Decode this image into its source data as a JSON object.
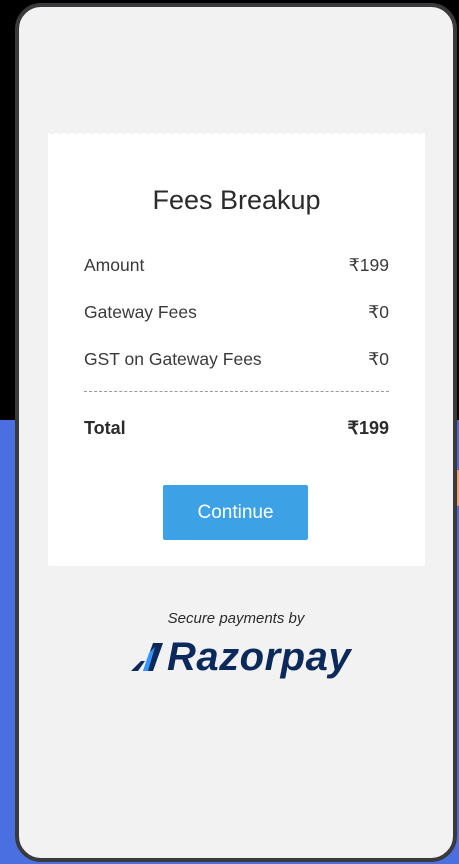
{
  "card": {
    "title": "Fees Breakup",
    "rows": [
      {
        "label": "Amount",
        "value": "₹199"
      },
      {
        "label": "Gateway Fees",
        "value": "₹0"
      },
      {
        "label": "GST on Gateway Fees",
        "value": "₹0"
      }
    ],
    "total": {
      "label": "Total",
      "value": "₹199"
    },
    "continue_label": "Continue"
  },
  "footer": {
    "secure_text": "Secure payments by",
    "brand_name": "Razorpay"
  },
  "colors": {
    "accent": "#3da1e6",
    "brand": "#0b2a5b",
    "brand_logo": "#3395ff",
    "background_blue": "#4a6fe0"
  }
}
